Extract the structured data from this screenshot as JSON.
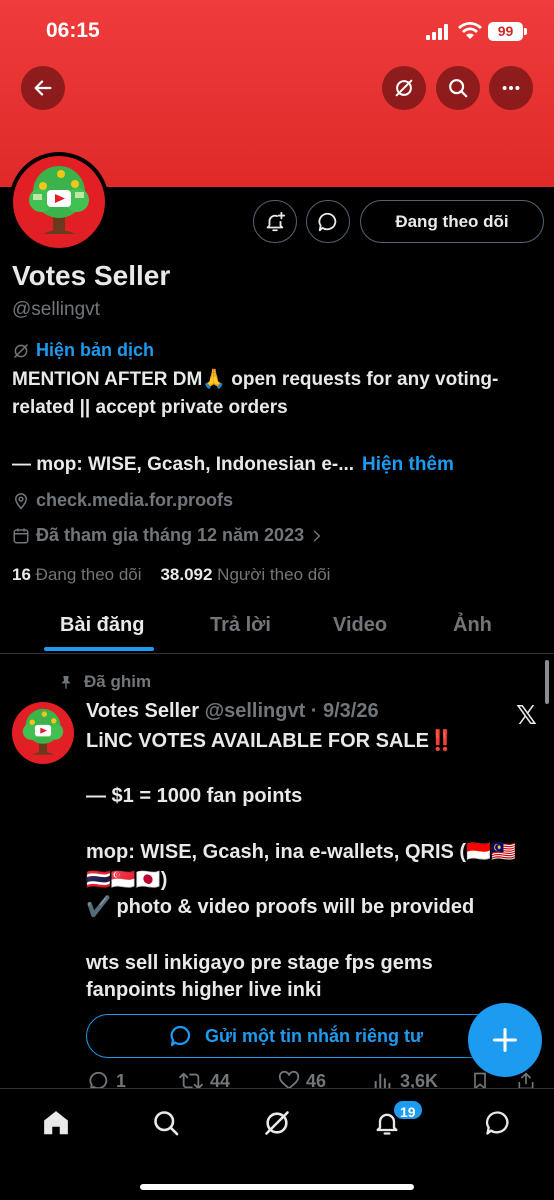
{
  "status_bar": {
    "time": "06:15",
    "battery": "99"
  },
  "header": {
    "back_icon": "arrow-left-icon",
    "translate_icon": "translate-slash-icon",
    "search_icon": "search-icon",
    "more_icon": "more-horizontal-icon",
    "banner_color": "#e5302f"
  },
  "profile": {
    "name": "Votes Seller",
    "handle": "@sellingvt",
    "follow_button": "Đang theo dõi",
    "translate_label": "Hiện bản dịch",
    "bio_line1": "MENTION AFTER DM🙏 open requests for any voting-related || accept private orders",
    "bio_line2": "— mop: WISE, Gcash, Indonesian e-...",
    "show_more": "Hiện thêm",
    "location": "check.media.for.proofs",
    "joined": "Đã tham gia tháng 12 năm 2023",
    "following_count": "16",
    "following_label": "Đang theo dõi",
    "followers_count": "38.092",
    "followers_label": "Người theo dõi"
  },
  "tabs": [
    {
      "label": "Bài đăng",
      "active": true
    },
    {
      "label": "Trả lời",
      "active": false
    },
    {
      "label": "Video",
      "active": false
    },
    {
      "label": "Ảnh",
      "active": false
    }
  ],
  "pinned_tweet": {
    "pinned_label": "Đã ghim",
    "author": "Votes Seller",
    "handle_date": "@sellingvt · 9/3/26",
    "x_logo": "𝕏",
    "body": "LiNC VOTES AVAILABLE FOR SALE‼️\n\n— $1 = 1000 fan points\n\nmop: WISE, Gcash, ina e-wallets, QRIS (🇮🇩🇲🇾\n🇹🇭🇸🇬🇯🇵)\n✔️ photo & video proofs will be provided\n\nwts sell inkigayo pre stage fps gems\nfanpoints higher live inki",
    "dm_button": "Gửi một tin nhắn riêng tư",
    "replies": "1",
    "retweets": "44",
    "likes": "46",
    "views": "3,6K"
  },
  "bottom_nav": {
    "notifications_badge": "19",
    "accent_color": "#1d9bf0"
  }
}
